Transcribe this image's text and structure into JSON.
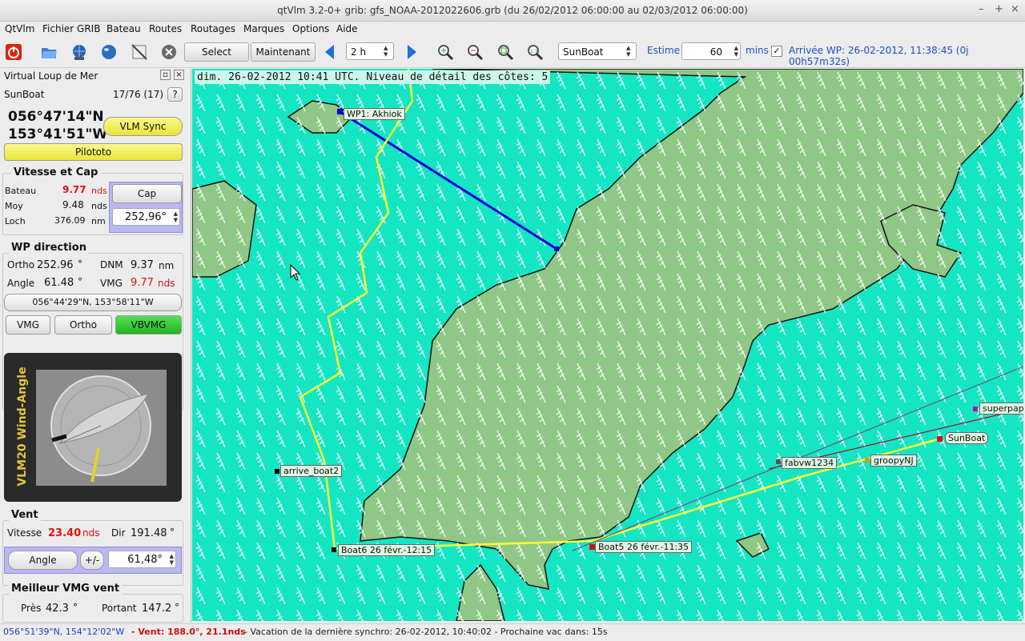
{
  "window": {
    "title": "qtVlm 3.2-0+ grib: gfs_NOAA-2012022606.grb (du 26/02/2012 06:00:00 au 02/03/2012 06:00:00)",
    "controls": [
      "–",
      "+",
      "×"
    ]
  },
  "menu": [
    "QtVlm",
    "Fichier GRIB",
    "Bateau",
    "Routes",
    "Routages",
    "Marques",
    "Options",
    "Aide"
  ],
  "toolbar": {
    "select_label": "Select",
    "now_label": "Maintenant",
    "step_value": "2 h",
    "boat_value": "SunBoat",
    "estime_label": "Estime",
    "estime_value": "60",
    "mins_label": "mins",
    "arrival_label": "Arrivée WP: 26-02-2012, 11:38:45 (0j 00h57m32s)"
  },
  "panel": {
    "title": "Virtual Loup de Mer",
    "boat_name": "SunBoat",
    "rank": "17/76 (17)",
    "help": "?",
    "lat": "056°47'14\"N",
    "lon": "153°41'51\"W",
    "sync_label": "VLM Sync",
    "pilot_label": "Pilototo",
    "speed_section": {
      "title": "Vitesse et Cap",
      "bateau_label": "Bateau",
      "bateau_value": "9.77",
      "bateau_unit": "nds",
      "moy_label": "Moy",
      "moy_value": "9.48",
      "moy_unit": "nds",
      "loch_label": "Loch",
      "loch_value": "376.09",
      "loch_unit": "nm",
      "cap_label": "Cap",
      "cap_value": "252,96°"
    },
    "wp_section": {
      "title": "WP direction",
      "ortho_label": "Ortho",
      "ortho_value": "252.96",
      "ortho_unit": "°",
      "dnm_label": "DNM",
      "dnm_value": "9.37",
      "dnm_unit": "nm",
      "angle_label": "Angle",
      "angle_value": "61.48",
      "angle_unit": "°",
      "vmg_label": "VMG",
      "vmg_value": "9.77",
      "vmg_unit": "nds",
      "coords": "056°44'29\"N, 153°58'11\"W",
      "mode_vmg": "VMG",
      "mode_ortho": "Ortho",
      "mode_vbvmg": "VBVMG"
    },
    "instrument_label": "VLM20 Wind-Angle",
    "wind_section": {
      "title": "Vent",
      "vitesse_label": "Vitesse",
      "vitesse_value": "23.40",
      "vitesse_unit": "nds",
      "dir_label": "Dir",
      "dir_value": "191.48",
      "dir_unit": "°",
      "angle_button": "Angle",
      "plusminus": "+/-",
      "angle_value": "61,48°"
    },
    "best_vmg": {
      "title": "Meilleur VMG vent",
      "pres_label": "Près",
      "pres_value": "42.3",
      "pres_unit": "°",
      "portant_label": "Portant",
      "portant_value": "147.2",
      "portant_unit": "°"
    }
  },
  "map": {
    "header": "dim. 26-02-2012 10:41 UTC. Niveau de détail des côtes: 5",
    "labels": {
      "wp1": "WP1: Akhiok",
      "arrive_boat2": "arrive_boat2",
      "boat6": "Boat6 26 févr.-12:15",
      "boat5": "Boat5 26 févr.-11:35",
      "fabvw": "fabvw1234",
      "groopy": "groopyNJ",
      "sunboat": "SunBoat",
      "superpap": "superpap"
    },
    "colors": {
      "sea": "#14e5c3",
      "land": "#8fc786",
      "route": "#ffff33",
      "wp_line": "#0000dd"
    }
  },
  "status": {
    "coords": "056°51'39\"N, 154°12'02\"W",
    "wind": "- Vent: 188.0°, 21.1nds",
    "rest": "- Vacation de la dernière synchro: 26-02-2012, 10:40:02 - Prochaine vac dans: 15s"
  }
}
